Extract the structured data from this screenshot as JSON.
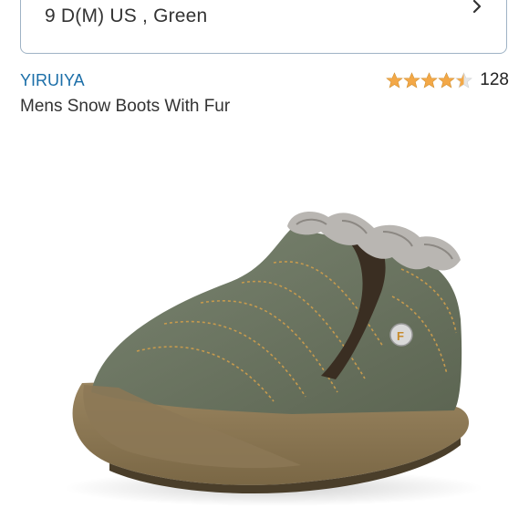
{
  "variant": {
    "selected": "9 D(M) US , Green"
  },
  "product": {
    "brand": "YIRUIYA",
    "title": "Mens Snow Boots With Fur",
    "rating_value": 4.5,
    "rating_max": 5,
    "review_count": "128"
  },
  "colors": {
    "brand_link": "#1b6ea8",
    "star_fill": "#f3a847",
    "star_empty": "#dddddd",
    "boot_green": "#6b7560",
    "sole_tan": "#8a7650"
  },
  "icons": {
    "variant_chevron": "chevron-right-icon",
    "star": "star-icon"
  }
}
